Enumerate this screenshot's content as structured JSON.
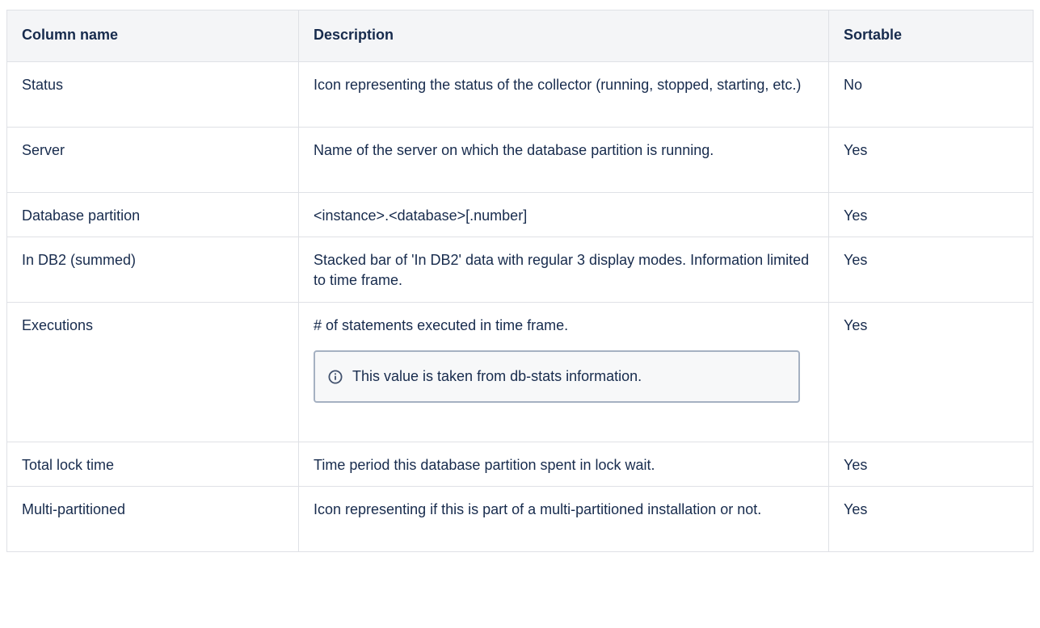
{
  "table": {
    "headers": [
      "Column name",
      "Description",
      "Sortable"
    ],
    "rows": [
      {
        "name": "Status",
        "description": "Icon representing the status of the collector (running, stopped, starting, etc.)",
        "sortable": "No"
      },
      {
        "name": "Server",
        "description": "Name of the server on which the database partition is running.",
        "sortable": "Yes"
      },
      {
        "name": "Database partition",
        "description": "<instance>.<database>[.number]",
        "sortable": "Yes"
      },
      {
        "name": "In DB2 (summed)",
        "description": "Stacked bar of 'In DB2' data with regular 3 display modes. Information limited to time frame.",
        "sortable": "Yes"
      },
      {
        "name": "Executions",
        "description": "# of statements executed in time frame.",
        "note": "This value is taken from db-stats information.",
        "sortable": "Yes"
      },
      {
        "name": "Total lock time",
        "description": "Time period this database partition spent in lock wait.",
        "sortable": "Yes"
      },
      {
        "name": "Multi-partitioned",
        "description": "Icon representing if this is part of a multi-partitioned installation or not.",
        "sortable": "Yes"
      }
    ]
  },
  "icons": {
    "note_icon": "info-circle-icon"
  },
  "colors": {
    "header_bg": "#f4f5f7",
    "border": "#dfe1e6",
    "text": "#172b4d",
    "note_border": "#a5b1c2"
  }
}
